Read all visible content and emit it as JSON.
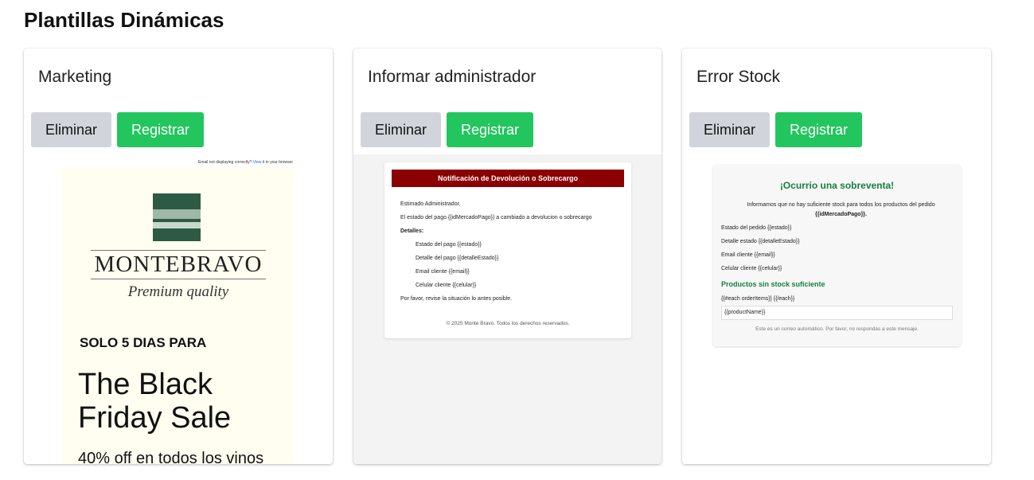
{
  "page": {
    "title": "Plantillas Dinámicas"
  },
  "buttons": {
    "delete_label": "Eliminar",
    "register_label": "Registrar"
  },
  "colors": {
    "register": "#22c55e",
    "delete": "#d1d5db",
    "notification_header": "#8b0000",
    "success_green": "#15803d"
  },
  "cards": [
    {
      "title": "Marketing",
      "preview": {
        "top_notice": "Email not displaying correctly?",
        "top_notice_link": "View",
        "top_notice_tail": "it in your browser",
        "brand": "MONTEBRAVO",
        "tagline": "Premium quality",
        "pre_heading": "SOLO 5 DIAS PARA",
        "headline": "The Black Friday Sale",
        "offer": "40% off en todos los vinos",
        "logo_icon": "mountain-landscape-logo"
      }
    },
    {
      "title": "Informar administrador",
      "preview": {
        "header": "Notificación de Devolución o Sobrecargo",
        "greeting": "Estimado Administrador,",
        "intro": "El estado del pago {{idMercadoPago}} a cambiado a devolucion o sobrecargo",
        "details_label": "Detalles:",
        "details": [
          "Estado del pago {{estado}}",
          "Detalle del pago {{detalleEstado}}",
          "Email cliente {{email}}",
          "Celular cliente {{celular}}"
        ],
        "closing": "Por favor, revise la situación lo antes posible.",
        "footer": "© 2025 Monte Bravo. Todos los derechos reservados."
      }
    },
    {
      "title": "Error Stock",
      "preview": {
        "heading": "¡Ocurrio una sobreventa!",
        "intro": "Informamos que no hay suficiente stock para todos los productos del pedido",
        "order_id": "{{idMercadoPago}}.",
        "lines": [
          "Estado del pedido {{estado}}",
          "Detalle estado {{detalleEstado}}",
          "Email cliente {{email}}",
          "Celular cliente {{celular}}"
        ],
        "subheading": "Productos sin stock suficiente",
        "loop": "{{#each orderItems}} {{/each}}",
        "field": "{{productName}}",
        "footer": "Este es un correo automático. Por favor, no respondas a este mensaje."
      }
    }
  ]
}
